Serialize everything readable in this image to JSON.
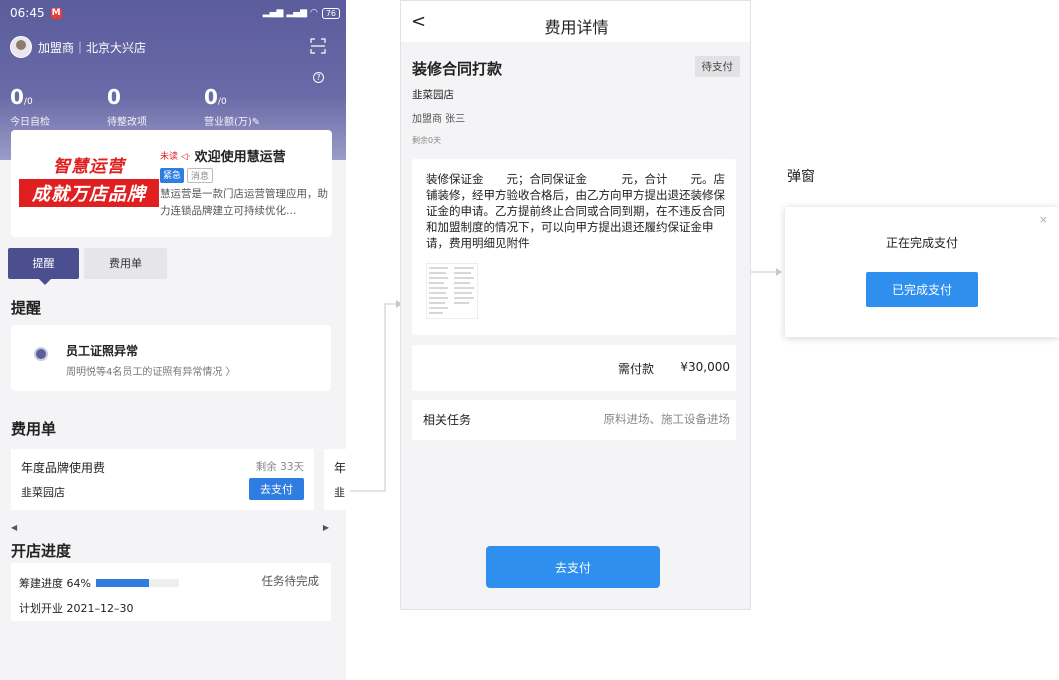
{
  "screen1": {
    "status": {
      "time": "06:45",
      "badge": "M",
      "battery": "76"
    },
    "user": {
      "label": "加盟商｜北京大兴店"
    },
    "stats": [
      {
        "num": "0",
        "unit": "/0",
        "label": "今日自检"
      },
      {
        "num": "0",
        "unit": "",
        "label": "待整改项"
      },
      {
        "num": "0",
        "unit": "/0",
        "label": "营业额(万)✎"
      }
    ],
    "banner": {
      "logo_line1": "智慧运营",
      "logo_line2": "成就万店品牌",
      "unread": "未读 ◁·",
      "title": "欢迎使用慧运营",
      "tag_urgent": "紧急",
      "tag_msg": "消息",
      "desc": "慧运营是一款门店运营管理应用，助力连锁品牌建立可持续优化…"
    },
    "tabs": [
      {
        "label": "提醒"
      },
      {
        "label": "费用单"
      }
    ],
    "reminder_section": "提醒",
    "reminder": {
      "title": "员工证照异常",
      "sub": "周明悦等4名员工的证照有异常情况 〉"
    },
    "fee_section": "费用单",
    "fee": {
      "name": "年度品牌使用费",
      "remain": "剩余 33天",
      "store": "韭菜园店",
      "pay": "去支付",
      "next_name": "年",
      "next_store": "韭"
    },
    "progress_section": "开店进度",
    "progress": {
      "label": "筹建进度 64%",
      "value": 0.64,
      "status": "任务待完成",
      "plan": "计划开业 2021–12–30"
    }
  },
  "screen2": {
    "title": "费用详情",
    "contract_name": "装修合同打款",
    "badge": "待支付",
    "store": "韭菜园店",
    "person": "加盟商 张三",
    "remain": "剩余0天",
    "content": "装修保证金　　元；合同保证金　　　元，合计　　元。店铺装修，经甲方验收合格后，由乙方向甲方提出退还装修保证金的申请。乙方提前终止合同或合同到期，在不违反合同和加盟制度的情况下，可以向甲方提出退还履约保证金申请，费用明细见附件",
    "pay_label": "需付款",
    "pay_amount": "¥30,000",
    "task_label": "相关任务",
    "task_value": "原料进场、施工设备进场",
    "go_pay": "去支付"
  },
  "popup": {
    "section_label": "弹窗",
    "title": "正在完成支付",
    "button": "已完成支付",
    "close": "×"
  },
  "colors": {
    "primary": "#2f7de1",
    "tab_active": "#4b4f8f",
    "hero": "#5b5c9c",
    "logo_red": "#e02020"
  }
}
